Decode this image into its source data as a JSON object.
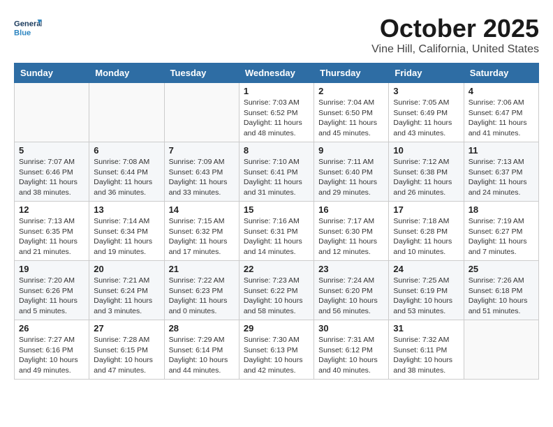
{
  "header": {
    "logo_general": "General",
    "logo_blue": "Blue",
    "month": "October 2025",
    "location": "Vine Hill, California, United States"
  },
  "weekdays": [
    "Sunday",
    "Monday",
    "Tuesday",
    "Wednesday",
    "Thursday",
    "Friday",
    "Saturday"
  ],
  "weeks": [
    [
      {
        "day": "",
        "content": ""
      },
      {
        "day": "",
        "content": ""
      },
      {
        "day": "",
        "content": ""
      },
      {
        "day": "1",
        "content": "Sunrise: 7:03 AM\nSunset: 6:52 PM\nDaylight: 11 hours\nand 48 minutes."
      },
      {
        "day": "2",
        "content": "Sunrise: 7:04 AM\nSunset: 6:50 PM\nDaylight: 11 hours\nand 45 minutes."
      },
      {
        "day": "3",
        "content": "Sunrise: 7:05 AM\nSunset: 6:49 PM\nDaylight: 11 hours\nand 43 minutes."
      },
      {
        "day": "4",
        "content": "Sunrise: 7:06 AM\nSunset: 6:47 PM\nDaylight: 11 hours\nand 41 minutes."
      }
    ],
    [
      {
        "day": "5",
        "content": "Sunrise: 7:07 AM\nSunset: 6:46 PM\nDaylight: 11 hours\nand 38 minutes."
      },
      {
        "day": "6",
        "content": "Sunrise: 7:08 AM\nSunset: 6:44 PM\nDaylight: 11 hours\nand 36 minutes."
      },
      {
        "day": "7",
        "content": "Sunrise: 7:09 AM\nSunset: 6:43 PM\nDaylight: 11 hours\nand 33 minutes."
      },
      {
        "day": "8",
        "content": "Sunrise: 7:10 AM\nSunset: 6:41 PM\nDaylight: 11 hours\nand 31 minutes."
      },
      {
        "day": "9",
        "content": "Sunrise: 7:11 AM\nSunset: 6:40 PM\nDaylight: 11 hours\nand 29 minutes."
      },
      {
        "day": "10",
        "content": "Sunrise: 7:12 AM\nSunset: 6:38 PM\nDaylight: 11 hours\nand 26 minutes."
      },
      {
        "day": "11",
        "content": "Sunrise: 7:13 AM\nSunset: 6:37 PM\nDaylight: 11 hours\nand 24 minutes."
      }
    ],
    [
      {
        "day": "12",
        "content": "Sunrise: 7:13 AM\nSunset: 6:35 PM\nDaylight: 11 hours\nand 21 minutes."
      },
      {
        "day": "13",
        "content": "Sunrise: 7:14 AM\nSunset: 6:34 PM\nDaylight: 11 hours\nand 19 minutes."
      },
      {
        "day": "14",
        "content": "Sunrise: 7:15 AM\nSunset: 6:32 PM\nDaylight: 11 hours\nand 17 minutes."
      },
      {
        "day": "15",
        "content": "Sunrise: 7:16 AM\nSunset: 6:31 PM\nDaylight: 11 hours\nand 14 minutes."
      },
      {
        "day": "16",
        "content": "Sunrise: 7:17 AM\nSunset: 6:30 PM\nDaylight: 11 hours\nand 12 minutes."
      },
      {
        "day": "17",
        "content": "Sunrise: 7:18 AM\nSunset: 6:28 PM\nDaylight: 11 hours\nand 10 minutes."
      },
      {
        "day": "18",
        "content": "Sunrise: 7:19 AM\nSunset: 6:27 PM\nDaylight: 11 hours\nand 7 minutes."
      }
    ],
    [
      {
        "day": "19",
        "content": "Sunrise: 7:20 AM\nSunset: 6:26 PM\nDaylight: 11 hours\nand 5 minutes."
      },
      {
        "day": "20",
        "content": "Sunrise: 7:21 AM\nSunset: 6:24 PM\nDaylight: 11 hours\nand 3 minutes."
      },
      {
        "day": "21",
        "content": "Sunrise: 7:22 AM\nSunset: 6:23 PM\nDaylight: 11 hours\nand 0 minutes."
      },
      {
        "day": "22",
        "content": "Sunrise: 7:23 AM\nSunset: 6:22 PM\nDaylight: 10 hours\nand 58 minutes."
      },
      {
        "day": "23",
        "content": "Sunrise: 7:24 AM\nSunset: 6:20 PM\nDaylight: 10 hours\nand 56 minutes."
      },
      {
        "day": "24",
        "content": "Sunrise: 7:25 AM\nSunset: 6:19 PM\nDaylight: 10 hours\nand 53 minutes."
      },
      {
        "day": "25",
        "content": "Sunrise: 7:26 AM\nSunset: 6:18 PM\nDaylight: 10 hours\nand 51 minutes."
      }
    ],
    [
      {
        "day": "26",
        "content": "Sunrise: 7:27 AM\nSunset: 6:16 PM\nDaylight: 10 hours\nand 49 minutes."
      },
      {
        "day": "27",
        "content": "Sunrise: 7:28 AM\nSunset: 6:15 PM\nDaylight: 10 hours\nand 47 minutes."
      },
      {
        "day": "28",
        "content": "Sunrise: 7:29 AM\nSunset: 6:14 PM\nDaylight: 10 hours\nand 44 minutes."
      },
      {
        "day": "29",
        "content": "Sunrise: 7:30 AM\nSunset: 6:13 PM\nDaylight: 10 hours\nand 42 minutes."
      },
      {
        "day": "30",
        "content": "Sunrise: 7:31 AM\nSunset: 6:12 PM\nDaylight: 10 hours\nand 40 minutes."
      },
      {
        "day": "31",
        "content": "Sunrise: 7:32 AM\nSunset: 6:11 PM\nDaylight: 10 hours\nand 38 minutes."
      },
      {
        "day": "",
        "content": ""
      }
    ]
  ]
}
